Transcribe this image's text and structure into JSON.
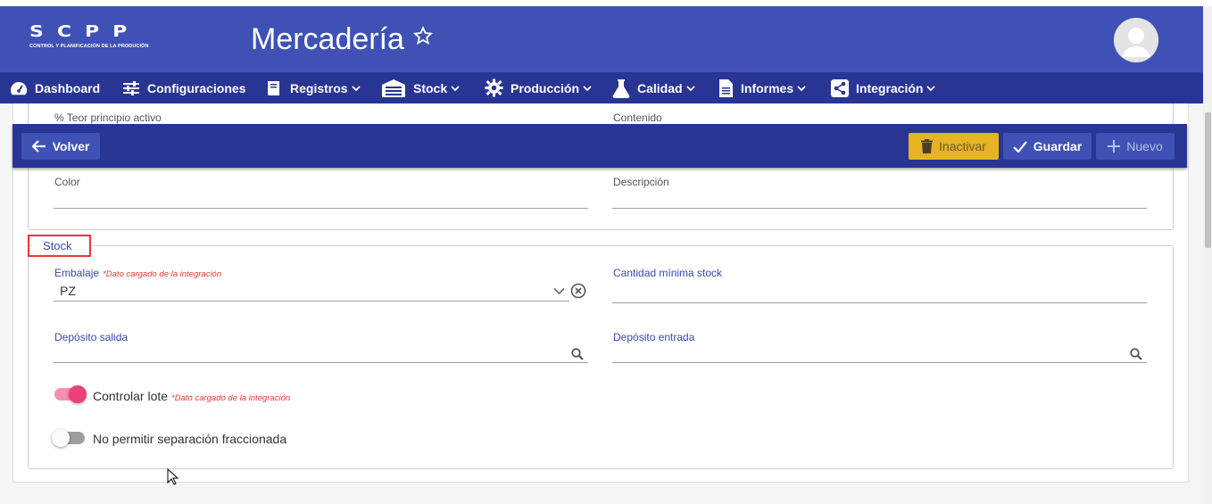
{
  "header": {
    "logo_big": "SCPP",
    "logo_small": "CONTROL Y PLANIFICACIÓN DE LA PRODUCIÓN",
    "title": "Mercadería",
    "star_icon": "star-outline-icon",
    "avatar_icon": "user-avatar-icon"
  },
  "nav": {
    "items": [
      {
        "label": "Dashboard",
        "icon": "dashboard-gauge-icon"
      },
      {
        "label": "Configuraciones",
        "icon": "sliders-icon"
      },
      {
        "label": "Registros",
        "icon": "book-icon"
      },
      {
        "label": "Stock",
        "icon": "warehouse-icon"
      },
      {
        "label": "Producción",
        "icon": "gear-icon"
      },
      {
        "label": "Calidad",
        "icon": "flask-icon"
      },
      {
        "label": "Informes",
        "icon": "document-icon"
      },
      {
        "label": "Integración",
        "icon": "share-icon"
      }
    ]
  },
  "toolbar": {
    "back_label": "Volver",
    "inactivar_label": "Inactivar",
    "guardar_label": "Guardar",
    "nuevo_label": "Nuevo"
  },
  "form": {
    "teor_label": "% Teor principio activo",
    "contenido_label": "Contenido",
    "color_label": "Color",
    "color_value": "",
    "descripcion_label": "Descripción",
    "descripcion_value": ""
  },
  "stock": {
    "legend": "Stock",
    "embalaje_label": "Embalaje",
    "integration_note": "*Dato cargado de la integración",
    "embalaje_value": "PZ",
    "cantidad_label": "Cantidad mínima stock",
    "cantidad_value": "",
    "deposito_salida_label": "Depósito salida",
    "deposito_entrada_label": "Depósito entrada",
    "controlar_lote_label": "Controlar lote",
    "controlar_lote_on": true,
    "no_permitir_label": "No permitir separación fraccionada",
    "no_permitir_on": false
  },
  "colors": {
    "header_bg": "#3f51b5",
    "nav_bg": "#283593",
    "accent_pink": "#f06292",
    "warning_yellow": "#e6b325",
    "error_red": "#e53935"
  }
}
